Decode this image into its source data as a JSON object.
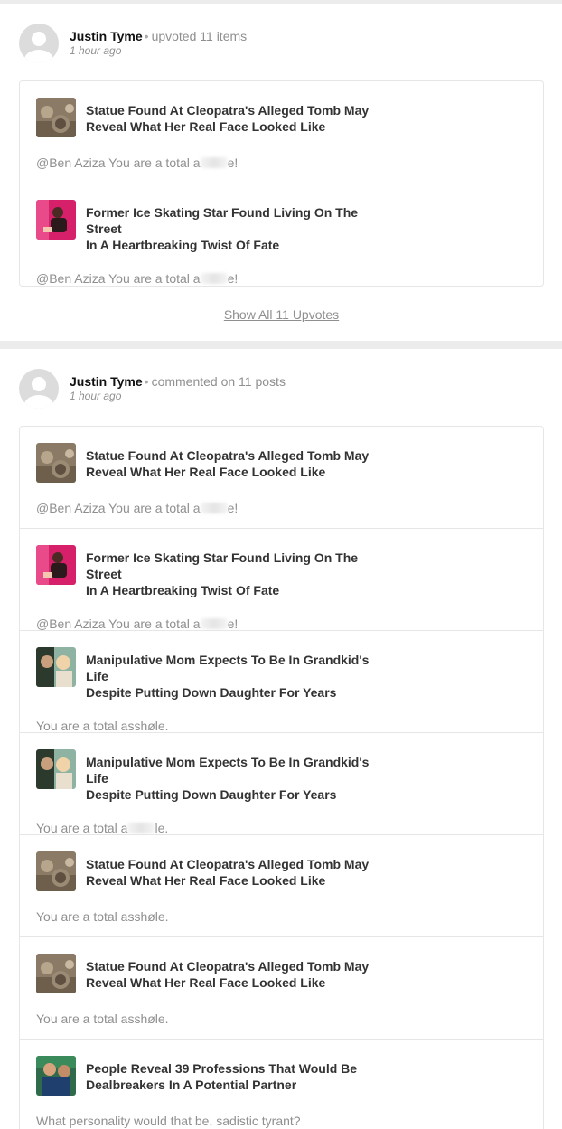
{
  "activities": [
    {
      "user": "Justin Tyme",
      "separator": "•",
      "action": "upvoted 11 items",
      "time": "1 hour ago",
      "items": [
        {
          "title_line1": "Statue Found At Cleopatra's Alleged Tomb May",
          "title_line2": "Reveal What Her Real Face Looked Like",
          "thumb": "statue",
          "comment_before": "@Ben Aziza You are a total a",
          "comment_after": "e!",
          "redacted": true
        },
        {
          "title_line1": "Former Ice Skating Star Found Living On The Street",
          "title_line2": "In A Heartbreaking Twist Of Fate",
          "thumb": "skater",
          "comment_before": "@Ben Aziza You are a total a",
          "comment_after": "e!",
          "redacted": true
        }
      ],
      "show_all": "Show All 11 Upvotes"
    },
    {
      "user": "Justin Tyme",
      "separator": "•",
      "action": "commented on 11 posts",
      "time": "1 hour ago",
      "items": [
        {
          "title_line1": "Statue Found At Cleopatra's Alleged Tomb May",
          "title_line2": "Reveal What Her Real Face Looked Like",
          "thumb": "statue",
          "comment_before": "@Ben Aziza You are a total a",
          "comment_after": "e!",
          "redacted": true
        },
        {
          "title_line1": "Former Ice Skating Star Found Living On The Street",
          "title_line2": "In A Heartbreaking Twist Of Fate",
          "thumb": "skater",
          "comment_before": "@Ben Aziza You are a total a",
          "comment_after": "e!",
          "redacted": true
        },
        {
          "title_line1": "Manipulative Mom Expects To Be In Grandkid's Life",
          "title_line2": "Despite Putting Down Daughter For Years",
          "thumb": "mom",
          "comment_before": "You are a total asshøle.",
          "comment_after": "",
          "redacted": false
        },
        {
          "title_line1": "Manipulative Mom Expects To Be In Grandkid's Life",
          "title_line2": "Despite Putting Down Daughter For Years",
          "thumb": "mom",
          "comment_before": "You are a total a",
          "comment_after": "le.",
          "redacted": true
        },
        {
          "title_line1": "Statue Found At Cleopatra's Alleged Tomb May",
          "title_line2": "Reveal What Her Real Face Looked Like",
          "thumb": "statue",
          "comment_before": "You are a total asshøle.",
          "comment_after": "",
          "redacted": false
        },
        {
          "title_line1": "Statue Found At Cleopatra's Alleged Tomb May",
          "title_line2": "Reveal What Her Real Face Looked Like",
          "thumb": "statue",
          "comment_before": "You are a total asshøle.",
          "comment_after": "",
          "redacted": false
        },
        {
          "title_line1": "People Reveal 39 Professions That Would Be",
          "title_line2": "Dealbreakers In A Potential Partner",
          "thumb": "professions",
          "comment_before": "What personality would that be, sadistic tyrant?",
          "comment_after": "",
          "redacted": false
        }
      ]
    }
  ]
}
